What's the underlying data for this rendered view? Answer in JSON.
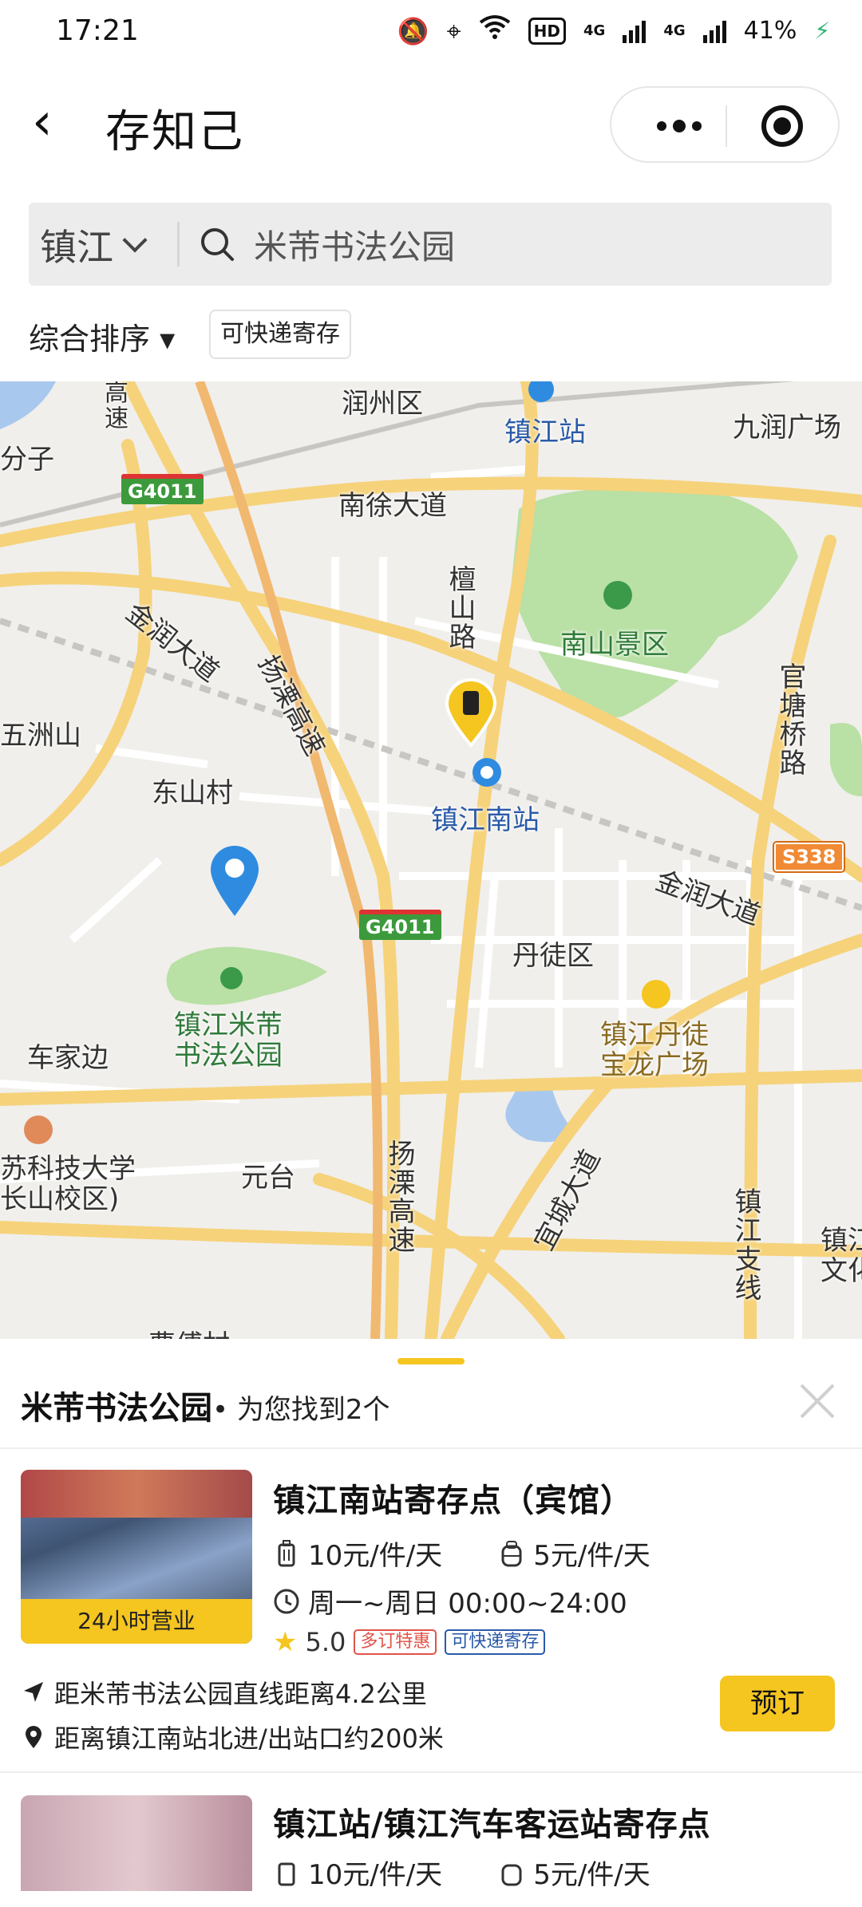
{
  "status_bar": {
    "time": "17:21",
    "hd_label": "HD",
    "signal_label_1": "4G",
    "signal_label_2": "4G",
    "battery": "41%"
  },
  "nav": {
    "title": "存知己"
  },
  "search": {
    "city": "镇江",
    "query": "米芾书法公园"
  },
  "filters": {
    "sort_label": "综合排序 ▾",
    "chip_label": "可快递寄存"
  },
  "map": {
    "labels": {
      "runzhou": "润州区",
      "zhenjiang_station": "镇江站",
      "jiurun_plaza": "九润广场",
      "fenzi": "分子",
      "g4011_a": "G4011",
      "nanxu": "南徐大道",
      "tanshan_road": "檀山路",
      "nanshan": "南山景区",
      "jinrun_a": "金润大道",
      "yangli_a": "扬溧高速",
      "guantang": "官塘桥路",
      "wuzhoushan": "五洲山",
      "dongshancun": "东山村",
      "zhenjiang_south": "镇江南站",
      "s338": "S338",
      "jinrun_b": "金润大道",
      "g4011_b": "G4011",
      "dantu": "丹徒区",
      "mifu_park": "镇江米芾\n书法公园",
      "chejiabian": "车家边",
      "baolong": "镇江丹徒\n宝龙广场",
      "university": "苏科技大学\n长山校区)",
      "yuantai": "元台",
      "yangli_b": "扬溧高速",
      "yicheng": "宜城大道",
      "zhenjiang_branch": "镇江支线",
      "zhenjiang_culture": "镇江\n文化",
      "caofucun": "曹傅村",
      "gaosu_top": "高速"
    }
  },
  "sheet": {
    "place": "米芾书法公园",
    "found_text": " • 为您找到2个",
    "listings": [
      {
        "title": "镇江南站寄存点（宾馆）",
        "badge": "24小时营业",
        "luggage_price": "10元/件/天",
        "bag_price": "5元/件/天",
        "hours": "周一~周日 00:00~24:00",
        "rating": "5.0",
        "tag_promo": "多订特惠",
        "tag_delivery": "可快递寄存",
        "distance_line": "距米芾书法公园直线距离4.2公里",
        "location_line": "距离镇江南站北进/出站口约200米",
        "book_label": "预订"
      },
      {
        "title": "镇江站/镇江汽车客运站寄存点",
        "luggage_price": "10元/件/天",
        "bag_price": "5元/件/天"
      }
    ]
  },
  "colors": {
    "accent_yellow": "#f5c520",
    "map_bg": "#f0efeb",
    "road_yellow": "#f6d27a",
    "park_green": "#b9e0a5",
    "water_blue": "#a9c8ee",
    "pin_blue": "#2e8be0"
  }
}
